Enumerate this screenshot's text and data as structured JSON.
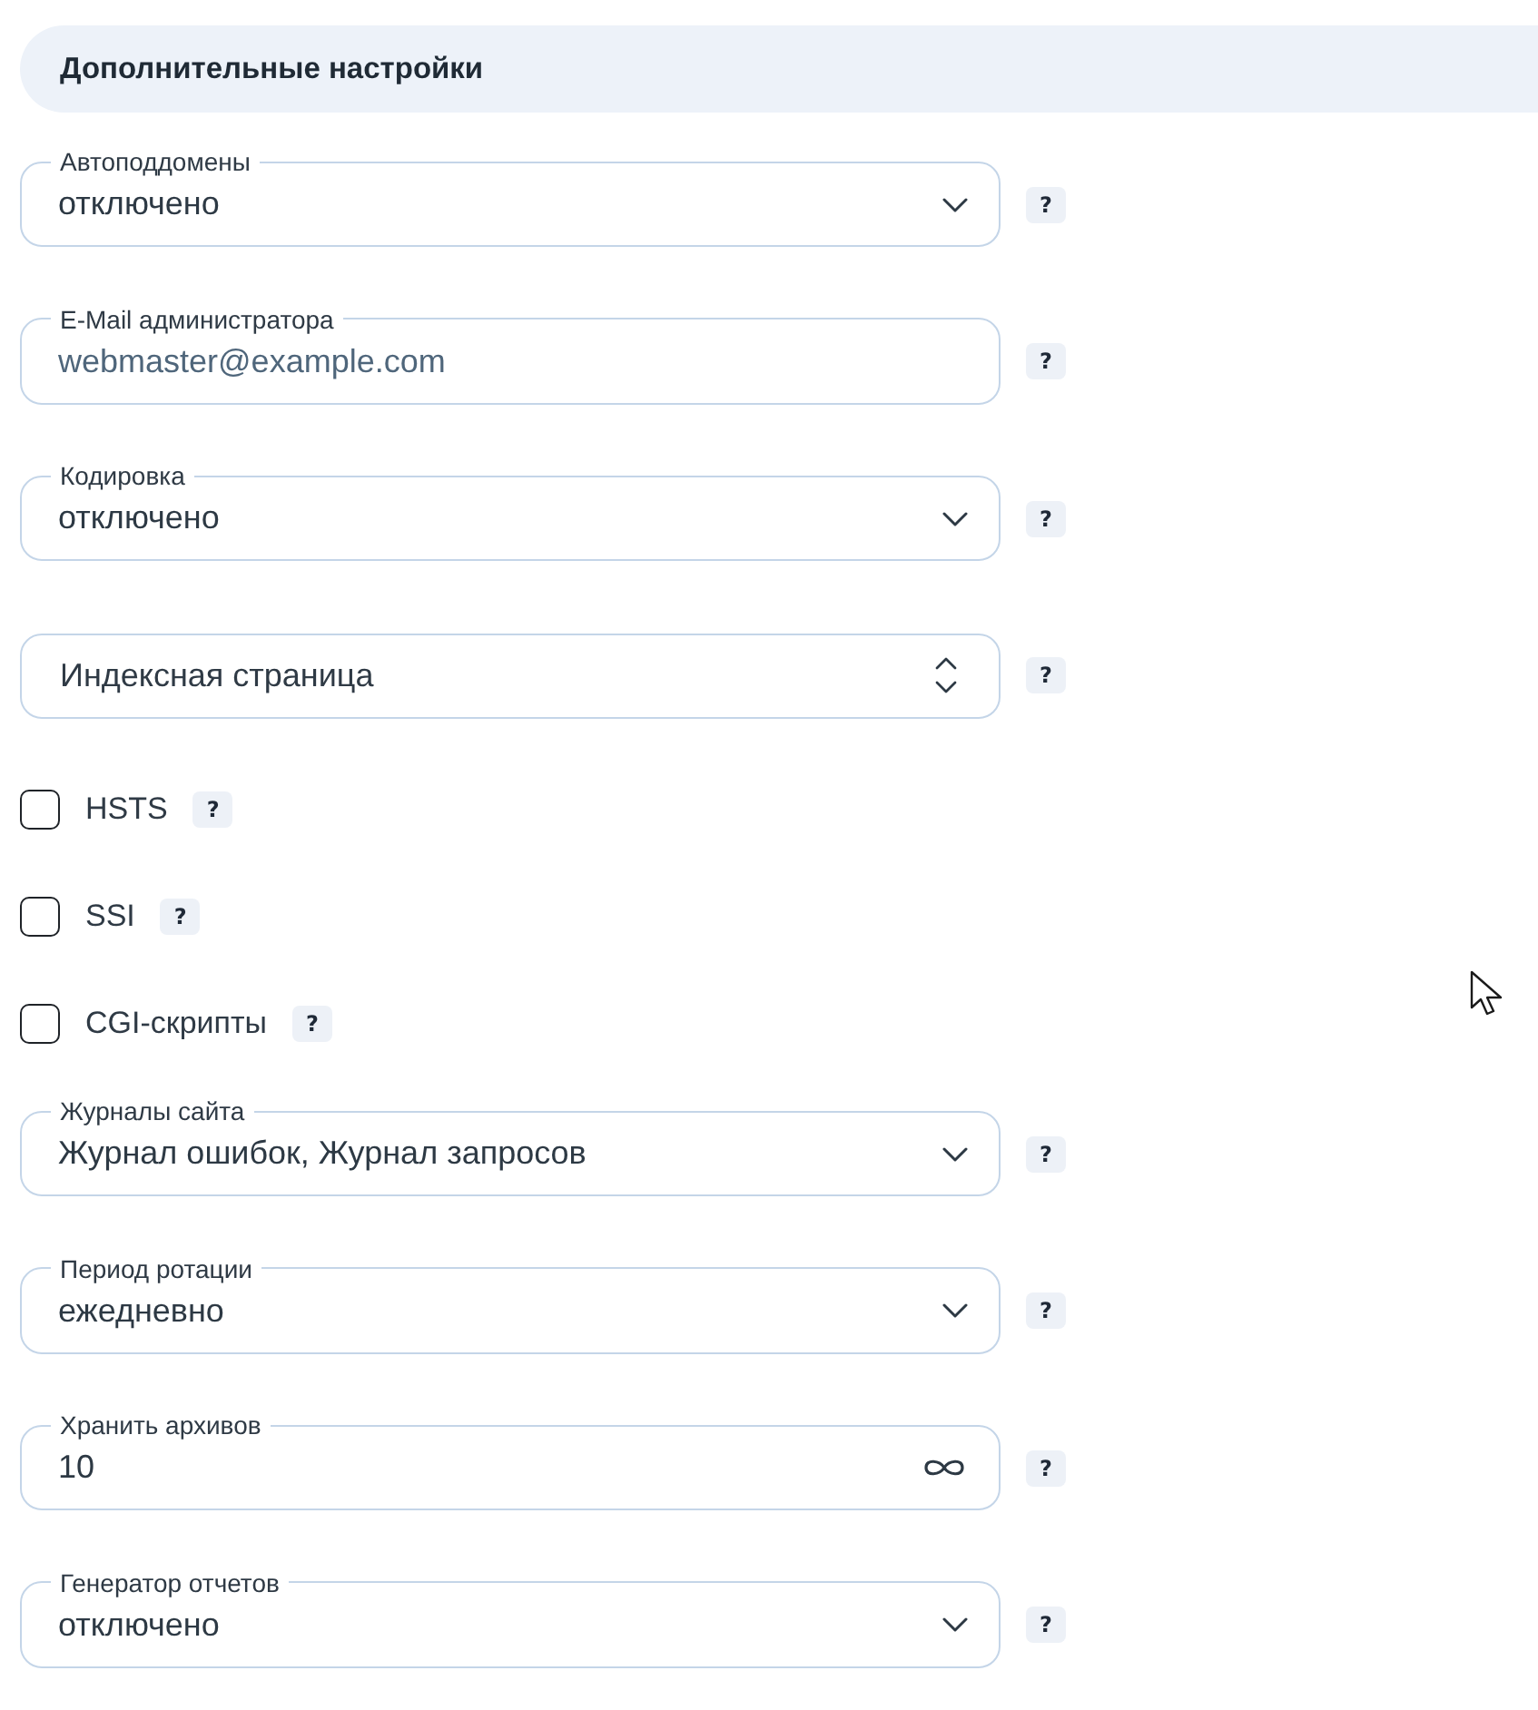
{
  "section": {
    "title": "Дополнительные настройки"
  },
  "rows": [
    {
      "kind": "select",
      "label": "Автоподдомены",
      "value": "отключено",
      "help": "?"
    },
    {
      "kind": "input",
      "label": "E-Mail администратора",
      "placeholder": "webmaster@example.com",
      "help": "?"
    },
    {
      "kind": "select",
      "label": "Кодировка",
      "value": "отключено",
      "help": "?"
    },
    {
      "kind": "sort-select",
      "label": "Индексная страница",
      "help": "?"
    },
    {
      "kind": "checkbox",
      "label": "HSTS",
      "checked": false,
      "help": "?"
    },
    {
      "kind": "checkbox",
      "label": "SSI",
      "checked": false,
      "help": "?"
    },
    {
      "kind": "checkbox",
      "label": "CGI-скрипты",
      "checked": false,
      "help": "?"
    },
    {
      "kind": "select",
      "label": "Журналы сайта",
      "value": "Журнал ошибок, Журнал запросов",
      "help": "?"
    },
    {
      "kind": "select",
      "label": "Период ротации",
      "value": "ежедневно",
      "help": "?"
    },
    {
      "kind": "number",
      "label": "Хранить архивов",
      "value": "10",
      "help": "?"
    },
    {
      "kind": "select",
      "label": "Генератор отчетов",
      "value": "отключено",
      "help": "?"
    }
  ]
}
